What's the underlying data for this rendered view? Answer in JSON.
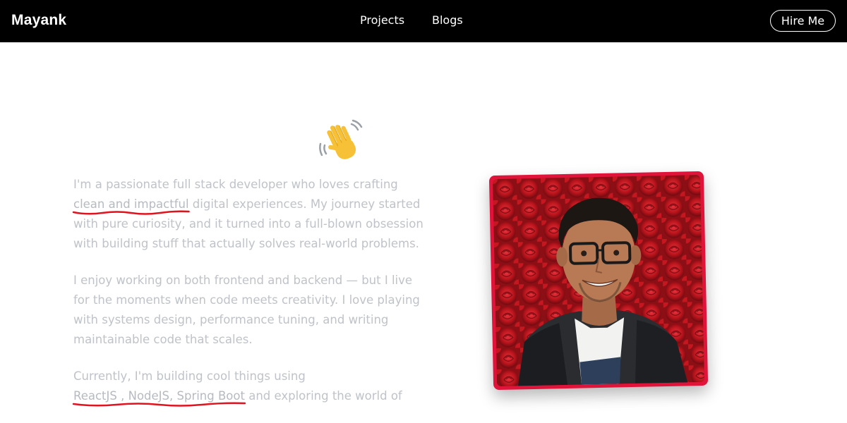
{
  "header": {
    "brand": "Mayank",
    "nav": [
      {
        "label": "Projects"
      },
      {
        "label": "Blogs"
      }
    ],
    "cta": "Hire Me"
  },
  "hero": {
    "emoji": "👋",
    "p1_before": "I'm a passionate full stack developer who loves crafting ",
    "p1_highlight": "clean and impactful",
    "p1_after": " digital experiences. My journey started with pure curiosity, and it turned into a full-blown obsession with building stuff that actually solves real-world problems.",
    "p2": "I enjoy working on both frontend and backend — but I live for the moments when code meets creativity. I love playing with systems design, performance tuning, and writing maintainable code that scales.",
    "p3_before": "Currently, I'm building cool things using ",
    "p3_highlight": "ReactJS , NodeJS, Spring Boot",
    "p3_after": " and exploring the world of"
  },
  "colors": {
    "navbar_bg": "#000000",
    "text_muted": "#bfc3c9",
    "underline": "#e0131e",
    "photo_border": "#e0133a"
  },
  "icons": {
    "wave": "waving-hand-icon"
  }
}
